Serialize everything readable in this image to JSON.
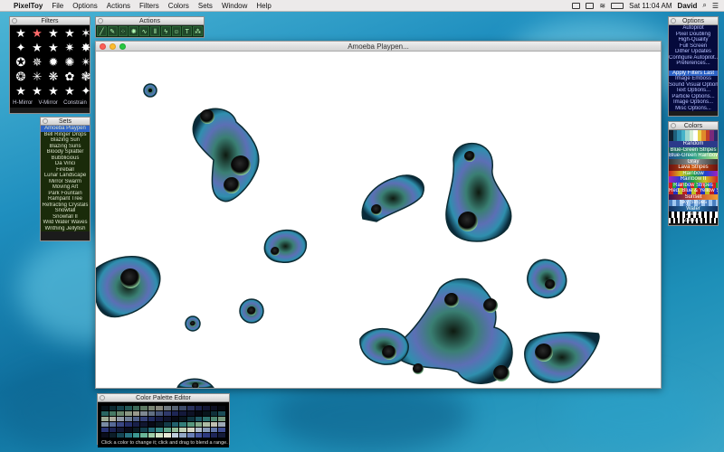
{
  "menubar": {
    "apple": "",
    "app_name": "PixelToy",
    "menus": [
      "File",
      "Options",
      "Actions",
      "Filters",
      "Colors",
      "Sets",
      "Window",
      "Help"
    ],
    "clock": "Sat 11:04 AM",
    "user": "David"
  },
  "filters_panel": {
    "title": "Filters",
    "footer": [
      "H-Mirror",
      "V-Mirror",
      "Constrain"
    ]
  },
  "actions_panel": {
    "title": "Actions"
  },
  "sets_panel": {
    "title": "Sets",
    "items": [
      "Amoeba Playpen",
      "Bell Ringer Drops",
      "Blazing Sun",
      "Blazing Suns",
      "Bloody Splatter",
      "Bubblicious",
      "Da Vinci",
      "Fireball",
      "Lunar Landscape",
      "Mirror Swarm",
      "Moving Art",
      "Park Fountain",
      "Rampant Tree",
      "Refracting Crystals",
      "Snowfall",
      "Snowfall II",
      "Wild Water Waves",
      "Writhing Jellyfish"
    ],
    "selected": 0
  },
  "options_panel": {
    "title": "Options",
    "items": [
      "Autopilot",
      "Pixel Doubling",
      "High-Quality",
      "Full Screen",
      "Dither Updates",
      "Configure Autopilot...",
      "Preferences..."
    ],
    "items2": [
      "Apply Filters Last",
      "Image Emboss",
      "Sound Visual Option...",
      "Text Options...",
      "Particle Options...",
      "Image Options...",
      "Misc Options..."
    ],
    "selected2": 0
  },
  "colors_panel": {
    "title": "Colors",
    "items": [
      "Random",
      "Blue-Green Stripes",
      "Blue-Green Rainbow",
      "Gray",
      "Lava Stripes",
      "Rainbow",
      "Rainbow II",
      "Rainbow Stripes",
      "Red, Blue & Yellow Stripes",
      "Sunset",
      "Sky Stripes",
      "Water",
      "Zebra",
      "Zebra II"
    ]
  },
  "main_window": {
    "title": "Amoeba Playpen..."
  },
  "palette_editor": {
    "title": "Color Palette Editor",
    "hint": "Click a color to change it; click and drag to blend a range."
  }
}
